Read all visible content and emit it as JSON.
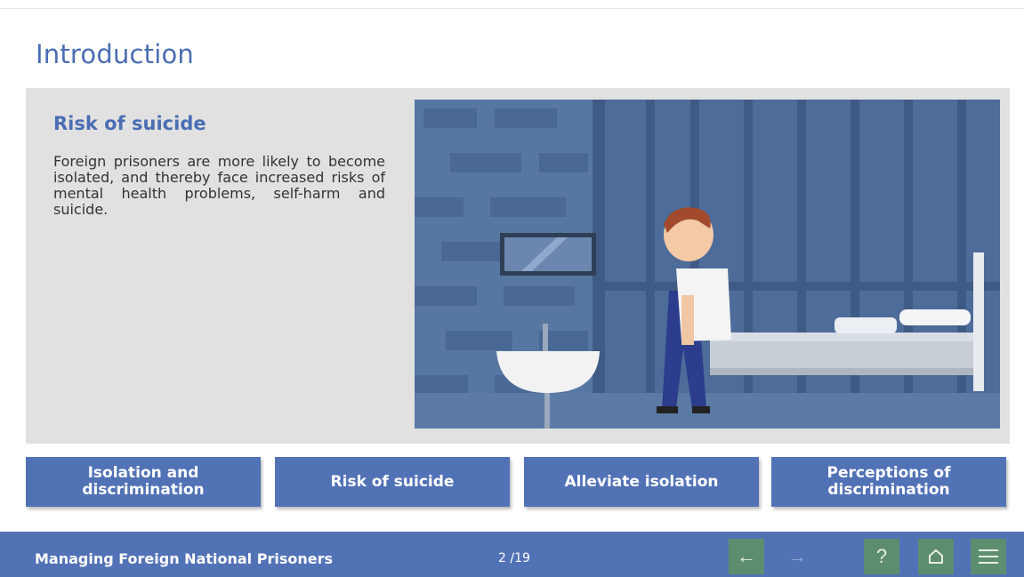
{
  "page": {
    "title": "Introduction"
  },
  "section": {
    "title": "Risk of suicide",
    "body": "Foreign prisoners are more likely to become isolated, and thereby face increased risks of mental health problems, self-harm and suicide."
  },
  "nav_buttons": [
    {
      "label": "Isolation and discrimination"
    },
    {
      "label": "Risk of suicide"
    },
    {
      "label": "Alleviate isolation"
    },
    {
      "label": "Perceptions of discrimination"
    }
  ],
  "footer": {
    "course_title": "Managing Foreign National Prisoners",
    "page_counter": "2 /19",
    "icons": [
      "back-arrow-icon",
      "forward-arrow-icon",
      "help-icon",
      "home-icon",
      "menu-icon"
    ]
  },
  "colors": {
    "accent": "#5272b6",
    "title": "#4a6db3",
    "footer_buttons": "#5d8d6f",
    "content_bg": "#e1e1e1"
  }
}
